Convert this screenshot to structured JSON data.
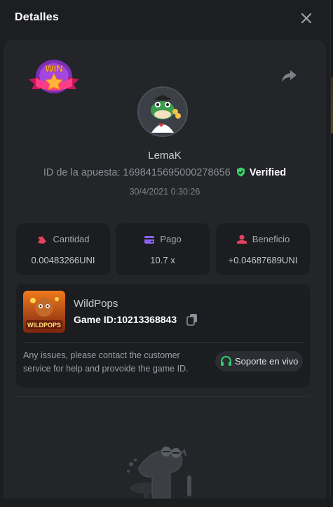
{
  "header": {
    "title": "Detalles",
    "close_icon": "close-icon"
  },
  "player": {
    "name": "LemaK",
    "bet_id_label": "ID de la apuesta:",
    "bet_id": "1698415695000278656",
    "verified": "Verified",
    "datetime": "30/4/2021 0:30:26"
  },
  "stats": [
    {
      "label": "Cantidad",
      "value": "0.00483266UNI",
      "icon": "bet-amount-icon",
      "color": "#e8405f"
    },
    {
      "label": "Pago",
      "value": "10.7 x",
      "icon": "wallet-icon",
      "color": "#8b63f0"
    },
    {
      "label": "Beneficio",
      "value": "+0.04687689UNI",
      "icon": "profit-icon",
      "color": "#e8405f"
    }
  ],
  "game": {
    "name": "WildPops",
    "id_label": "Game ID:",
    "id": "10213368843",
    "thumb_text": "WILDPOPS",
    "issue_text": "Any issues, please contact the customer service for help and provoide the game ID.",
    "support_label": "Soporte en vivo"
  },
  "badge": {
    "text": "WIN"
  },
  "colors": {
    "accent_green": "#2ecc71",
    "verified_green": "#3ad16b",
    "panel": "#232528"
  }
}
